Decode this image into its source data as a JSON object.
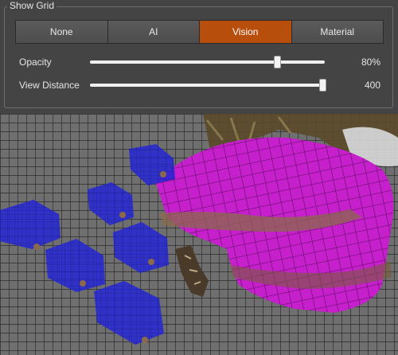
{
  "panel": {
    "title": "Show Grid",
    "tabs": [
      {
        "label": "None",
        "active": false
      },
      {
        "label": "AI",
        "active": false
      },
      {
        "label": "Vision",
        "active": true
      },
      {
        "label": "Material",
        "active": false
      }
    ],
    "opacity": {
      "label": "Opacity",
      "value_text": "80%",
      "fraction": 0.8
    },
    "view_distance": {
      "label": "View Distance",
      "value_text": "400",
      "fraction": 1.0
    }
  },
  "colors": {
    "accent": "#b84e0c",
    "ai_cell": "#2020d8",
    "vision_cell": "#c020c8"
  }
}
